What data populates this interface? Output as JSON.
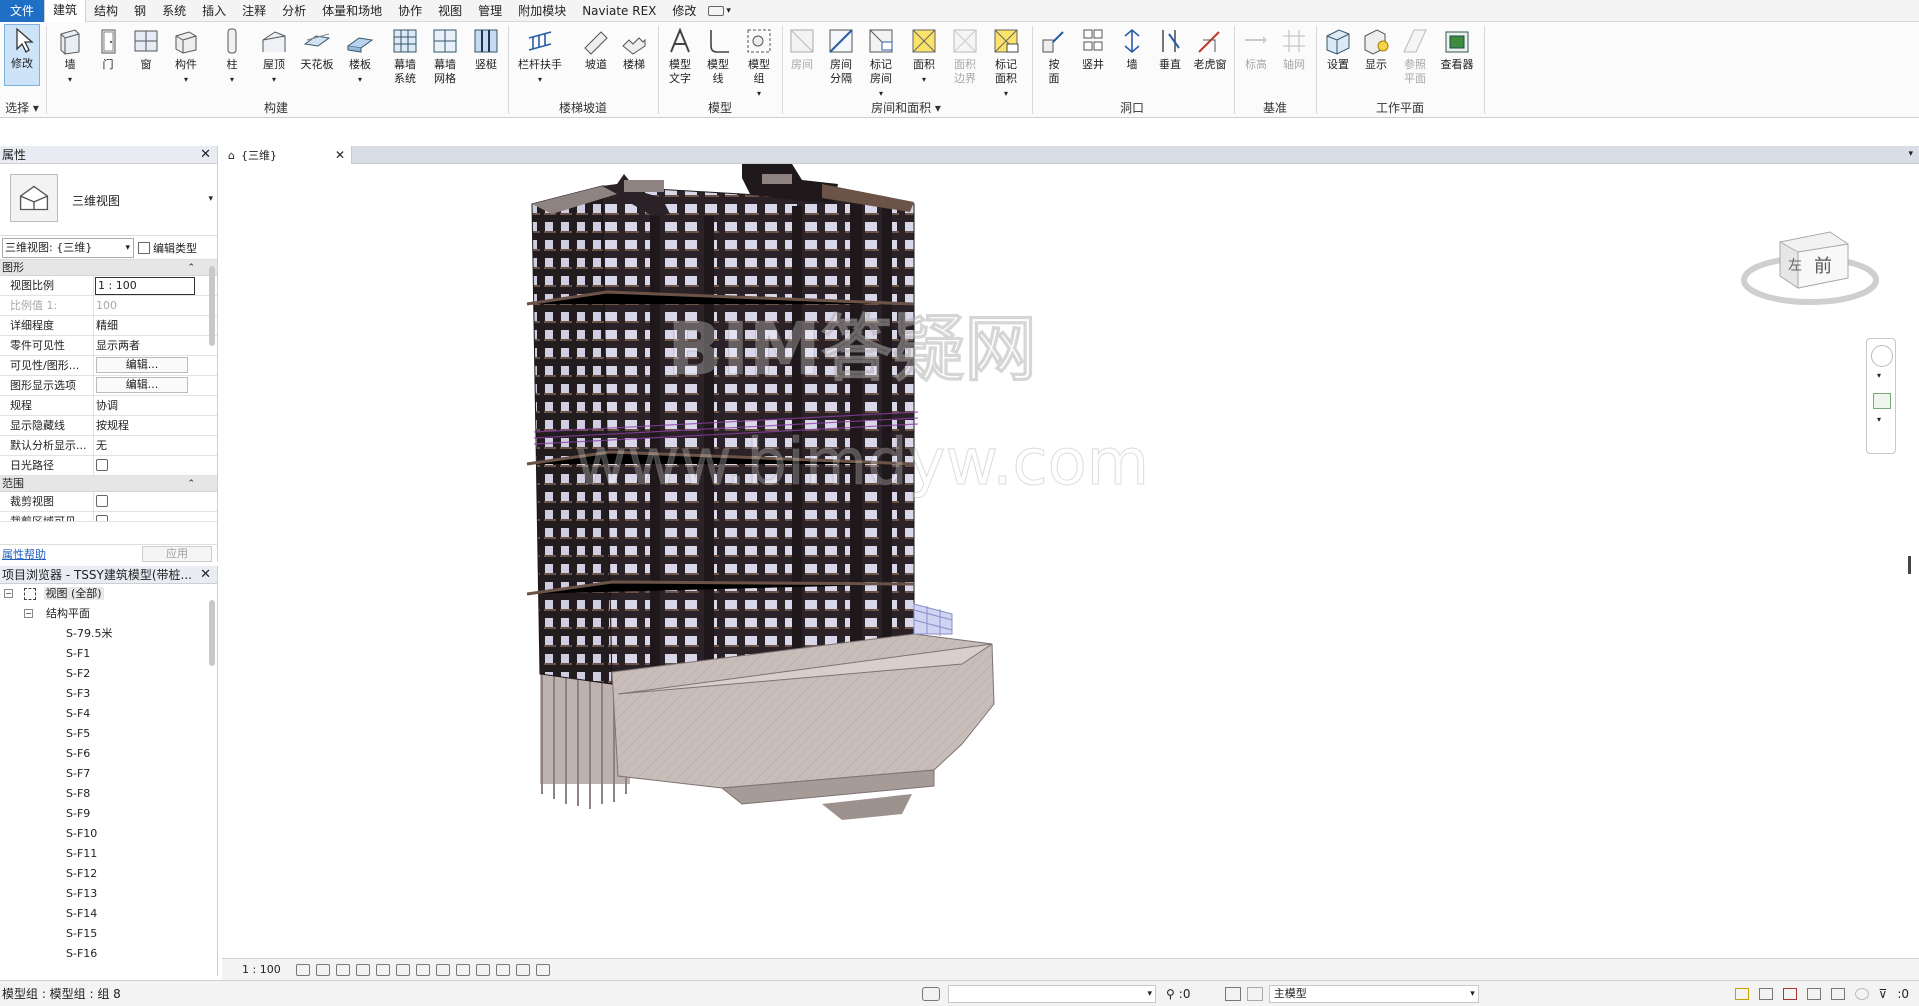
{
  "menu": {
    "tabs": [
      "文件",
      "建筑",
      "结构",
      "钢",
      "系统",
      "插入",
      "注释",
      "分析",
      "体量和场地",
      "协作",
      "视图",
      "管理",
      "附加模块",
      "Naviate REX",
      "修改"
    ],
    "active_tab": "建筑"
  },
  "ribbon": {
    "buttons": {
      "modify": "修改",
      "wall": "墙",
      "door": "门",
      "window": "窗",
      "component": "构件",
      "column": "柱",
      "roof": "屋顶",
      "ceiling": "天花板",
      "floor": "楼板",
      "curtain_system": "幕墙\n系统",
      "curtain_grid": "幕墙\n网格",
      "mullion": "竖梃",
      "railing": "栏杆扶手",
      "ramp": "坡道",
      "stair": "楼梯",
      "model_text": "模型\n文字",
      "model_line": "模型\n线",
      "model_group": "模型\n组",
      "room": "房间",
      "room_separator": "房间\n分隔",
      "tag_room": "标记\n房间",
      "area": "面积",
      "area_boundary": "面积\n边界",
      "tag_area": "标记\n面积",
      "by_face": "按\n面",
      "shaft": "竖井",
      "wall_opening": "墙",
      "vertical": "垂直",
      "dormer": "老虎窗",
      "level": "标高",
      "grid": "轴网",
      "set": "设置",
      "show": "显示",
      "ref_plane": "参照\n平面",
      "viewer": "查看器"
    },
    "panels": {
      "select": "选择",
      "build": "构建",
      "circulation": "楼梯坡道",
      "model": "模型",
      "room_area": "房间和面积",
      "opening": "洞口",
      "datum": "基准",
      "work_plane": "工作平面"
    }
  },
  "properties": {
    "title": "属性",
    "type_name": "三维视图",
    "view_selector": "三维视图: {三维}",
    "edit_type": "编辑类型",
    "sections": {
      "graphics": "图形",
      "extents": "范围"
    },
    "rows": [
      {
        "key": "视图比例",
        "value": "1 : 100"
      },
      {
        "key": "比例值 1:",
        "value": "100"
      },
      {
        "key": "详细程度",
        "value": "精细"
      },
      {
        "key": "零件可见性",
        "value": "显示两者"
      },
      {
        "key": "可见性/图形...",
        "value": "编辑..."
      },
      {
        "key": "图形显示选项",
        "value": "编辑..."
      },
      {
        "key": "规程",
        "value": "协调"
      },
      {
        "key": "显示隐藏线",
        "value": "按规程"
      },
      {
        "key": "默认分析显示...",
        "value": "无"
      },
      {
        "key": "日光路径",
        "value": ""
      }
    ],
    "extent_rows": [
      {
        "key": "裁剪视图",
        "value": ""
      },
      {
        "key": "裁剪区域可见",
        "value": ""
      }
    ],
    "help_link": "属性帮助",
    "apply": "应用"
  },
  "browser": {
    "title": "项目浏览器 - TSSY建筑模型(带桩...",
    "views_root": "视图 (全部)",
    "structural_plans": "结构平面",
    "items": [
      "S-79.5米",
      "S-F1",
      "S-F2",
      "S-F3",
      "S-F4",
      "S-F5",
      "S-F6",
      "S-F7",
      "S-F8",
      "S-F9",
      "S-F10",
      "S-F11",
      "S-F12",
      "S-F13",
      "S-F14",
      "S-F15",
      "S-F16"
    ]
  },
  "view": {
    "tab_title": "{三维}",
    "watermark_line1": "BIM答疑网",
    "watermark_line2": "www.bimdyw.com",
    "viewcube_left": "左",
    "viewcube_front": "前"
  },
  "view_control": {
    "scale": "1 : 100"
  },
  "status": {
    "message": "模型组 : 模型组 : 组 8",
    "sel_count": ":0",
    "main_model": "主模型",
    "filter_count": ":0"
  },
  "colors": {
    "file_tab": "#1f6fc6",
    "building_dark": "#2a2226",
    "building_band": "#6b5447",
    "podium": "#c9bdba",
    "windows": "#d9d7ea"
  }
}
